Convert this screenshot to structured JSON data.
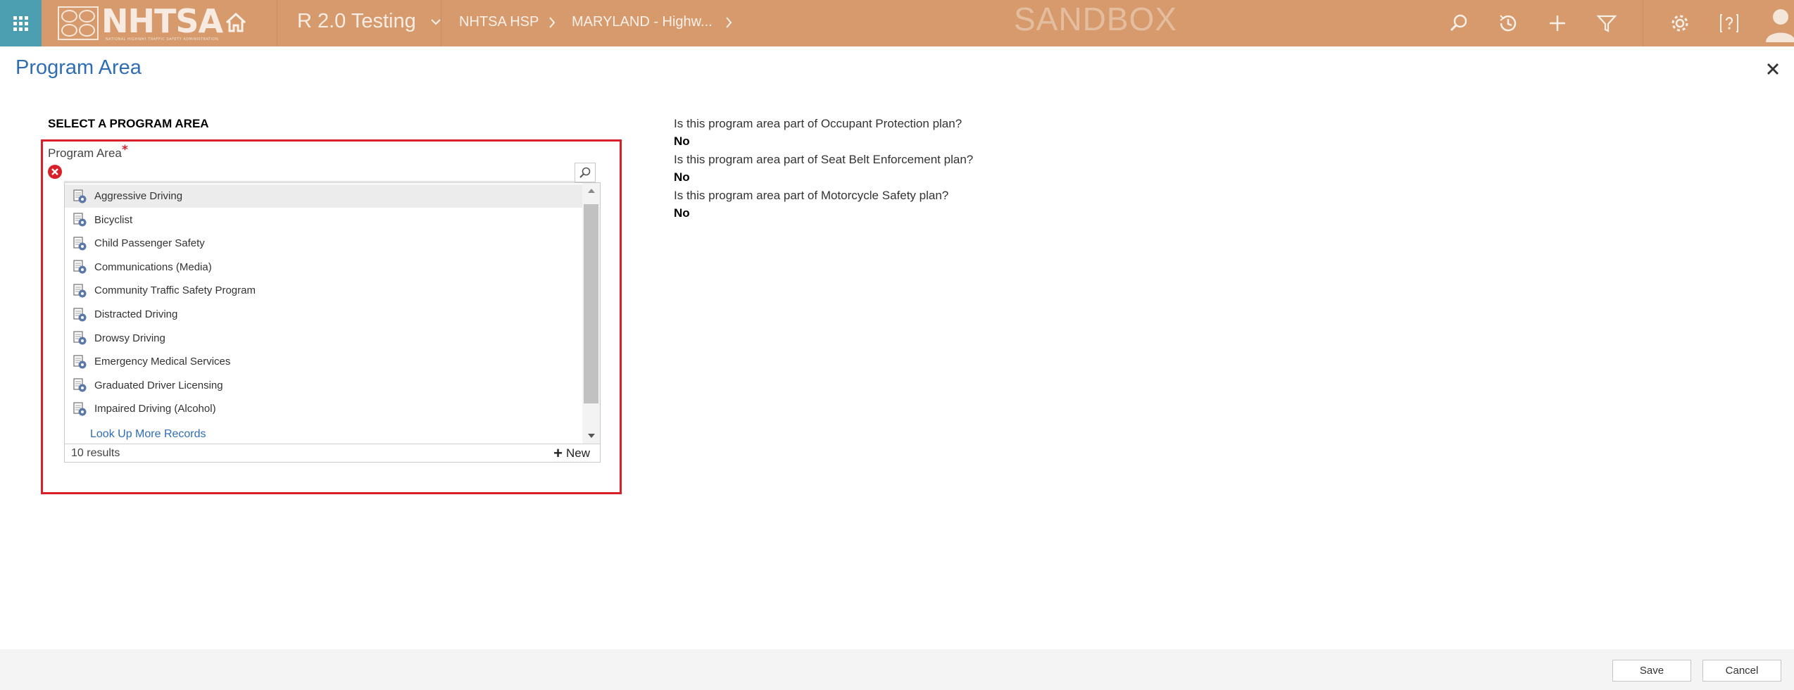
{
  "header": {
    "brand": "NHTSA",
    "brand_tagline": "NATIONAL HIGHWAY TRAFFIC SAFETY ADMINISTRATION",
    "app_name": "R 2.0 Testing",
    "breadcrumbs": [
      "NHTSA HSP",
      "MARYLAND - Highw..."
    ],
    "environment_watermark": "SANDBOX"
  },
  "dialog": {
    "title": "Program Area"
  },
  "section": {
    "title": "SELECT A PROGRAM AREA"
  },
  "field": {
    "label": "Program Area",
    "required_marker": "*",
    "value": "",
    "placeholder": ""
  },
  "dropdown": {
    "items": [
      "Aggressive Driving",
      "Bicyclist",
      "Child Passenger Safety",
      "Communications (Media)",
      "Community Traffic Safety Program",
      "Distracted Driving",
      "Drowsy Driving",
      "Emergency Medical Services",
      "Graduated Driver Licensing",
      "Impaired Driving (Alcohol)"
    ],
    "highlighted_index": 0,
    "more_link": "Look Up More Records",
    "result_count": "10 results",
    "new_label": "New"
  },
  "questions": [
    {
      "q": "Is this program area part of Occupant Protection plan?",
      "a": "No"
    },
    {
      "q": "Is this program area part of Seat Belt Enforcement plan?",
      "a": "No"
    },
    {
      "q": "Is this program area part of Motorcycle Safety plan?",
      "a": "No"
    }
  ],
  "footer": {
    "save_label": "Save",
    "cancel_label": "Cancel"
  },
  "colors": {
    "topbar": "#d69a6c",
    "waffle": "#4b9fb1",
    "accent_blue": "#2f6db5",
    "error_red": "#d9202a"
  },
  "icons": [
    "app-launcher-icon",
    "home-icon",
    "chevron-down-icon",
    "chevron-right-icon",
    "search-icon",
    "history-icon",
    "plus-icon",
    "filter-icon",
    "gear-icon",
    "help-icon",
    "user-avatar-icon",
    "close-icon",
    "error-icon",
    "entity-record-icon"
  ]
}
